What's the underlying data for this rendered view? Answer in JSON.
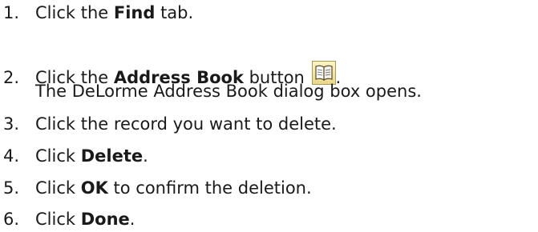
{
  "steps": [
    {
      "num": "1.",
      "pre": "Click the ",
      "bold": "Find",
      "post": " tab."
    },
    {
      "num": "2.",
      "pre": "Click the ",
      "bold": "Address Book",
      "post": " button ",
      "tail": ".",
      "icon": "address-book-icon",
      "cont": "The DeLorme Address Book dialog box opens."
    },
    {
      "num": "3.",
      "text": "Click the record you want to delete."
    },
    {
      "num": "4.",
      "pre": "Click ",
      "bold": "Delete",
      "post": "."
    },
    {
      "num": "5.",
      "pre": "Click ",
      "bold": "OK",
      "post": " to confirm the deletion."
    },
    {
      "num": "6.",
      "pre": "Click ",
      "bold": "Done",
      "post": "."
    }
  ]
}
